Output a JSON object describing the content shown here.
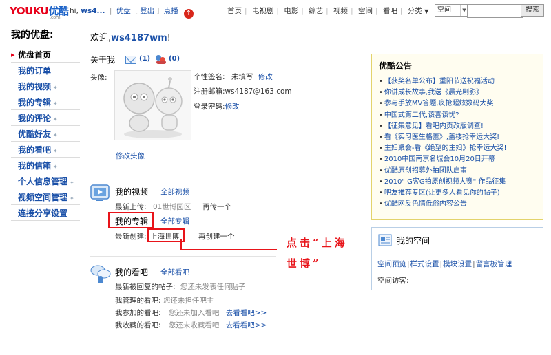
{
  "topbar": {
    "logo_main": "YOUKU",
    "logo_cn": "优酷",
    "logo_sub": ".com",
    "greeting_prefix": "hi,",
    "username_short": "ws4...",
    "links": [
      "优盘",
      "登出",
      "点播"
    ],
    "nav": [
      "首页",
      "电视剧",
      "电影",
      "综艺",
      "视频",
      "空间",
      "看吧",
      "分类"
    ],
    "search_scope": "空间",
    "search_placeholder": "",
    "search_button": "搜索"
  },
  "sidebar": {
    "title": "我的优盘:",
    "items": [
      {
        "label": "优盘首页"
      },
      {
        "label": "我的订单"
      },
      {
        "label": "我的视频"
      },
      {
        "label": "我的专辑"
      },
      {
        "label": "我的评论"
      },
      {
        "label": "优酷好友"
      },
      {
        "label": "我的看吧"
      },
      {
        "label": "我的信箱"
      },
      {
        "label": "个人信息管理"
      },
      {
        "label": "视频空间管理"
      },
      {
        "label": "连接分享设置"
      }
    ]
  },
  "welcome": {
    "prefix": "欢迎,",
    "username": "ws4187wm",
    "suffix": "!"
  },
  "about": {
    "title": "关于我",
    "mail_count": "(1)",
    "friend_count": "(0)",
    "avatar_label": "头像:",
    "change_avatar": "修改头像",
    "signature_label": "个性签名:",
    "signature_value": "未填写",
    "signature_edit": "修改",
    "email_label": "注册邮箱:",
    "email_value": "ws4187@163.com",
    "password_label": "登录密码:",
    "password_edit": "修改"
  },
  "videos": {
    "title": "我的视频",
    "all_link": "全部视频",
    "latest_label": "最新上传:",
    "latest_value": "01世博园区",
    "upload_again": "再传一个"
  },
  "albums": {
    "title": "我的专辑",
    "all_link": "全部专辑",
    "latest_label": "最新创建:",
    "latest_value": "上海世博",
    "create_again": "再创建一个"
  },
  "annotation": {
    "line1": "点击“上海",
    "line2": "世博”"
  },
  "bars": {
    "title": "我的看吧",
    "all_link": "全部看吧",
    "rows": [
      {
        "label": "最新被回复的帖子:",
        "value": "您还未发表任何贴子",
        "link": ""
      },
      {
        "label": "我管理的看吧:",
        "value": "您还未担任吧主",
        "link": ""
      },
      {
        "label": "我参加的看吧:",
        "value": "您还未加入看吧",
        "link": "去看看吧>>"
      },
      {
        "label": "我收藏的看吧:",
        "value": "您还未收藏看吧",
        "link": "去看看吧>>"
      }
    ]
  },
  "notice": {
    "title": "优酷公告",
    "items": [
      "【获奖名单公布】重阳节送祝福活动",
      "你讲成长故事,我送《晨光剧影》",
      "参与手放MV答题,疯抢超炫数码大奖!",
      "中国式第二代,该喜该忧?",
      "【征集意见】看吧内页改版调查!",
      "看《实习医生格蕾》,盖楼抢幸运大奖!",
      "主妇聚会-看《绝望的主妇》抢幸运大奖!",
      "2010中国南京名城会10月20日开幕",
      "优酷原创招募外拍团队启事",
      "2010\" G客G拍原创视频大赛\" 作品征集",
      "吧友推荐专区(让更多人看见你的帖子)",
      "优酷网反色情低俗内容公告"
    ]
  },
  "myspace": {
    "title": "我的空间",
    "links": [
      "空间预览",
      "样式设置",
      "模块设置",
      "留言板管理"
    ],
    "visitor_label": "空间访客:"
  },
  "colors": {
    "accent_red": "#e8141a",
    "link_blue": "#1a50a8",
    "notice_border": "#e3d36b"
  }
}
